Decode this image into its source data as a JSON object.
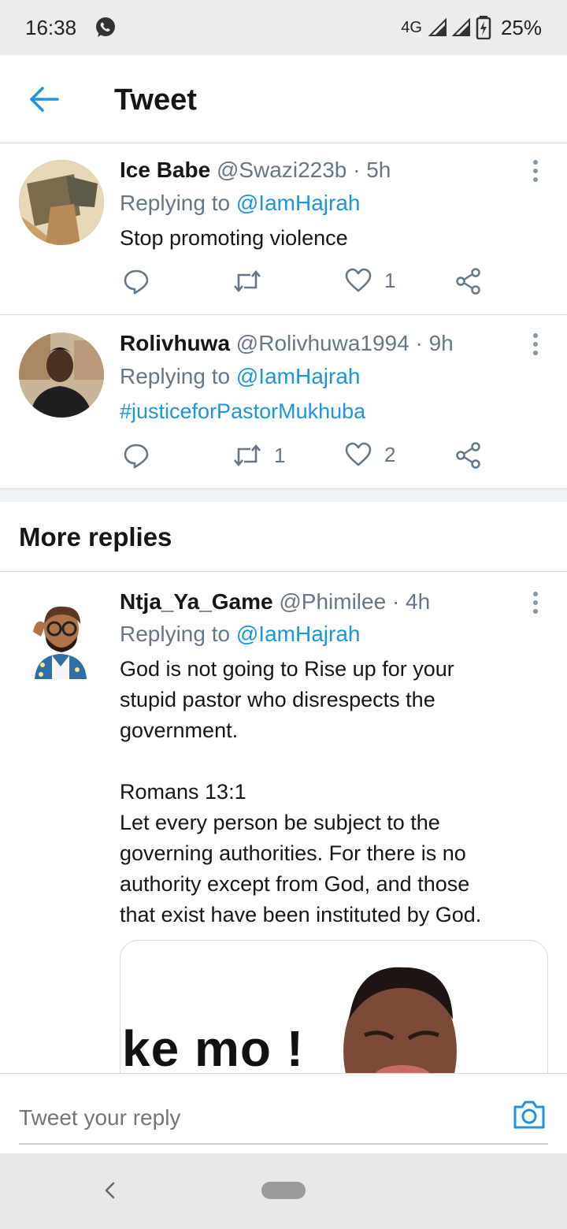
{
  "status_bar": {
    "time": "16:38",
    "network": "4G",
    "battery": "25%"
  },
  "header": {
    "title": "Tweet"
  },
  "tweets": [
    {
      "name": "Ice Babe",
      "handle": "@Swazi223b · 5h",
      "replying_prefix": "Replying to ",
      "replying_to": "@IamHajrah",
      "text": "Stop promoting violence",
      "retweets": "",
      "likes": "1"
    },
    {
      "name": "Rolivhuwa",
      "handle": "@Rolivhuwa1994 · 9h",
      "replying_prefix": "Replying to ",
      "replying_to": "@IamHajrah",
      "text": "#justiceforPastorMukhuba",
      "retweets": "1",
      "likes": "2"
    }
  ],
  "more_replies": {
    "label": "More replies",
    "tweet": {
      "name": "Ntja_Ya_Game",
      "handle": "@Phimilee · 4h",
      "replying_prefix": "Replying to ",
      "replying_to": "@IamHajrah",
      "text_lines": [
        "God is not going to Rise up for your",
        "stupid pastor who disrespects the",
        "government.",
        "",
        "Romans 13:1",
        "Let every person be subject to the",
        "governing authorities. For there is no",
        "authority except from God, and those",
        "that exist have been instituted by God."
      ],
      "media_caption": "ke mo !"
    }
  },
  "reply_bar": {
    "placeholder": "Tweet your reply"
  },
  "colors": {
    "accent": "#1b95e0",
    "text": "#14171a",
    "muted": "#657786"
  }
}
